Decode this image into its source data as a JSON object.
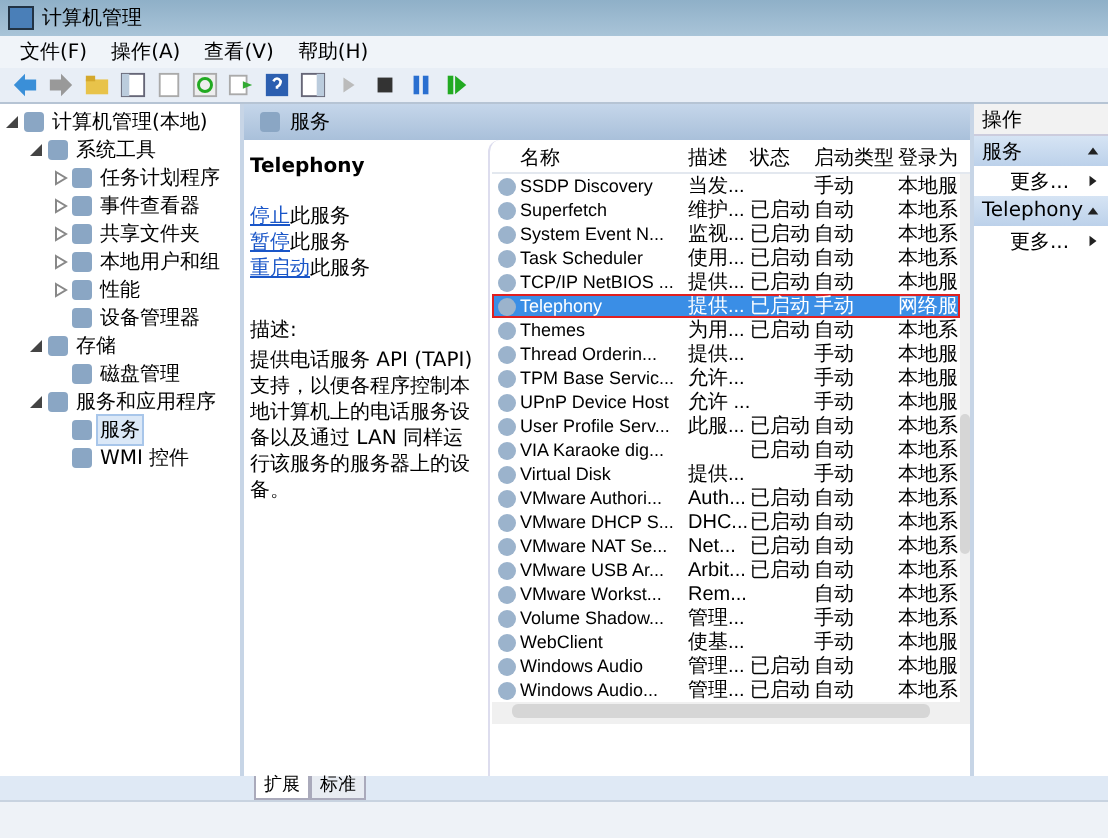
{
  "window": {
    "title": "计算机管理"
  },
  "menu": [
    {
      "label": "文件(F)"
    },
    {
      "label": "操作(A)"
    },
    {
      "label": "查看(V)"
    },
    {
      "label": "帮助(H)"
    }
  ],
  "tree": [
    {
      "label": "计算机管理(本地)",
      "expanded": true,
      "selected": false,
      "children": [
        {
          "label": "系统工具",
          "expanded": true,
          "selected": false,
          "children": [
            {
              "label": "任务计划程序",
              "expanded": false,
              "selected": false
            },
            {
              "label": "事件查看器",
              "expanded": false,
              "selected": false
            },
            {
              "label": "共享文件夹",
              "expanded": false,
              "selected": false
            },
            {
              "label": "本地用户和组",
              "expanded": false,
              "selected": false
            },
            {
              "label": "性能",
              "expanded": false,
              "selected": false
            },
            {
              "label": "设备管理器",
              "selected": false
            }
          ]
        },
        {
          "label": "存储",
          "expanded": true,
          "selected": false,
          "children": [
            {
              "label": "磁盘管理",
              "selected": false
            }
          ]
        },
        {
          "label": "服务和应用程序",
          "expanded": true,
          "selected": false,
          "children": [
            {
              "label": "服务",
              "selected": true
            },
            {
              "label": "WMI 控件",
              "selected": false
            }
          ]
        }
      ]
    }
  ],
  "center_title": "服务",
  "detail": {
    "name": "Telephony",
    "links": [
      {
        "link": "停止",
        "rest": "此服务"
      },
      {
        "link": "暂停",
        "rest": "此服务"
      },
      {
        "link": "重启动",
        "rest": "此服务"
      }
    ],
    "desc_label": "描述:",
    "description": "提供电话服务 API (TAPI)支持，以便各程序控制本地计算机上的电话服务设备以及通过 LAN 同样运行该服务的服务器上的设备。"
  },
  "table": {
    "columns": [
      "名称",
      "描述",
      "状态",
      "启动类型",
      "登录为"
    ],
    "rows": [
      {
        "cells": [
          "SSDP Discovery",
          "当发...",
          "",
          "手动",
          "本地服"
        ],
        "selected": false,
        "highlighted": false
      },
      {
        "cells": [
          "Superfetch",
          "维护...",
          "已启动",
          "自动",
          "本地系"
        ],
        "selected": false,
        "highlighted": false
      },
      {
        "cells": [
          "System Event N...",
          "监视...",
          "已启动",
          "自动",
          "本地系"
        ],
        "selected": false,
        "highlighted": false
      },
      {
        "cells": [
          "Task Scheduler",
          "使用...",
          "已启动",
          "自动",
          "本地系"
        ],
        "selected": false,
        "highlighted": false
      },
      {
        "cells": [
          "TCP/IP NetBIOS ...",
          "提供...",
          "已启动",
          "自动",
          "本地服"
        ],
        "selected": false,
        "highlighted": false
      },
      {
        "cells": [
          "Telephony",
          "提供...",
          "已启动",
          "手动",
          "网络服"
        ],
        "selected": true,
        "highlighted": true
      },
      {
        "cells": [
          "Themes",
          "为用...",
          "已启动",
          "自动",
          "本地系"
        ],
        "selected": false,
        "highlighted": false
      },
      {
        "cells": [
          "Thread Orderin...",
          "提供...",
          "",
          "手动",
          "本地服"
        ],
        "selected": false,
        "highlighted": false
      },
      {
        "cells": [
          "TPM Base Servic...",
          "允许...",
          "",
          "手动",
          "本地服"
        ],
        "selected": false,
        "highlighted": false
      },
      {
        "cells": [
          "UPnP Device Host",
          "允许 ...",
          "",
          "手动",
          "本地服"
        ],
        "selected": false,
        "highlighted": false
      },
      {
        "cells": [
          "User Profile Serv...",
          "此服...",
          "已启动",
          "自动",
          "本地系"
        ],
        "selected": false,
        "highlighted": false
      },
      {
        "cells": [
          "VIA Karaoke dig...",
          "",
          "已启动",
          "自动",
          "本地系"
        ],
        "selected": false,
        "highlighted": false
      },
      {
        "cells": [
          "Virtual Disk",
          "提供...",
          "",
          "手动",
          "本地系"
        ],
        "selected": false,
        "highlighted": false
      },
      {
        "cells": [
          "VMware Authori...",
          "Auth...",
          "已启动",
          "自动",
          "本地系"
        ],
        "selected": false,
        "highlighted": false
      },
      {
        "cells": [
          "VMware DHCP S...",
          "DHC...",
          "已启动",
          "自动",
          "本地系"
        ],
        "selected": false,
        "highlighted": false
      },
      {
        "cells": [
          "VMware NAT Se...",
          "Net...",
          "已启动",
          "自动",
          "本地系"
        ],
        "selected": false,
        "highlighted": false
      },
      {
        "cells": [
          "VMware USB Ar...",
          "Arbit...",
          "已启动",
          "自动",
          "本地系"
        ],
        "selected": false,
        "highlighted": false
      },
      {
        "cells": [
          "VMware Workst...",
          "Rem...",
          "",
          "自动",
          "本地系"
        ],
        "selected": false,
        "highlighted": false
      },
      {
        "cells": [
          "Volume Shadow...",
          "管理...",
          "",
          "手动",
          "本地系"
        ],
        "selected": false,
        "highlighted": false
      },
      {
        "cells": [
          "WebClient",
          "使基...",
          "",
          "手动",
          "本地服"
        ],
        "selected": false,
        "highlighted": false
      },
      {
        "cells": [
          "Windows Audio",
          "管理...",
          "已启动",
          "自动",
          "本地服"
        ],
        "selected": false,
        "highlighted": false
      },
      {
        "cells": [
          "Windows Audio...",
          "管理...",
          "已启动",
          "自动",
          "本地系"
        ],
        "selected": false,
        "highlighted": false
      }
    ]
  },
  "bottom_tabs": [
    {
      "label": "扩展",
      "selected": true
    },
    {
      "label": "标准",
      "selected": false
    }
  ],
  "actions": {
    "title": "操作",
    "groups": [
      {
        "label": "服务",
        "expanded": true,
        "items": [
          "更多..."
        ]
      },
      {
        "label": "Telephony",
        "expanded": true,
        "items": [
          "更多..."
        ]
      }
    ]
  }
}
